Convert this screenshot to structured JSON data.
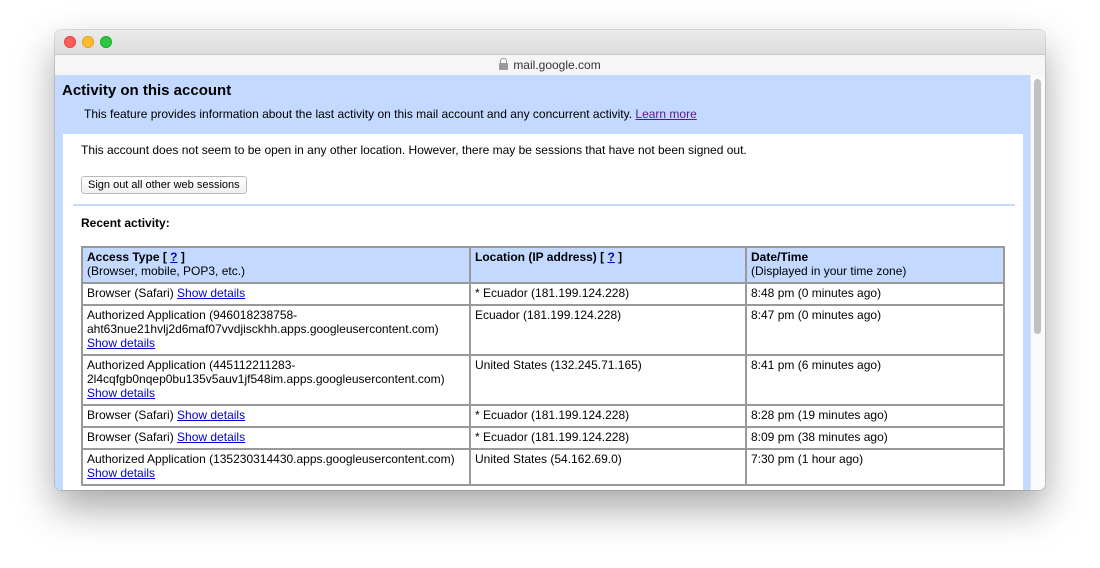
{
  "browser": {
    "url": "mail.google.com"
  },
  "page": {
    "title": "Activity on this account",
    "description": "This feature provides information about the last activity on this mail account and any concurrent activity.",
    "learn_more": "Learn more",
    "status_text": "This account does not seem to be open in any other location. However, there may be sessions that have not been signed out.",
    "signout_button": "Sign out all other web sessions",
    "recent_label": "Recent activity:"
  },
  "table": {
    "headers": [
      {
        "title": "Access Type",
        "help": "?",
        "sub": "(Browser, mobile, POP3, etc.)"
      },
      {
        "title": "Location (IP address)",
        "help": "?",
        "sub": ""
      },
      {
        "title": "Date/Time",
        "help": "",
        "sub": "(Displayed in your time zone)"
      }
    ],
    "rows": [
      {
        "access": "Browser (Safari)",
        "details": "Show details",
        "details_inline": true,
        "location": "* Ecuador (181.199.124.228)",
        "time": "8:48 pm (0 minutes ago)"
      },
      {
        "access": "Authorized Application (946018238758-aht63nue21hvlj2d6maf07vvdjisckhh.apps.googleusercontent.com)",
        "details": "Show details",
        "details_inline": false,
        "location": "Ecuador (181.199.124.228)",
        "time": "8:47 pm (0 minutes ago)"
      },
      {
        "access": "Authorized Application (445112211283-2l4cqfgb0nqep0bu135v5auv1jf548im.apps.googleusercontent.com)",
        "details": "Show details",
        "details_inline": false,
        "location": "United States (132.245.71.165)",
        "time": "8:41 pm (6 minutes ago)"
      },
      {
        "access": "Browser (Safari)",
        "details": "Show details",
        "details_inline": true,
        "location": "* Ecuador (181.199.124.228)",
        "time": "8:28 pm (19 minutes ago)"
      },
      {
        "access": "Browser (Safari)",
        "details": "Show details",
        "details_inline": true,
        "location": "* Ecuador (181.199.124.228)",
        "time": "8:09 pm (38 minutes ago)"
      },
      {
        "access": "Authorized Application (135230314430.apps.googleusercontent.com)",
        "details": "Show details",
        "details_inline": true,
        "location": "United States (54.162.69.0)",
        "time": "7:30 pm (1 hour ago)"
      }
    ]
  }
}
